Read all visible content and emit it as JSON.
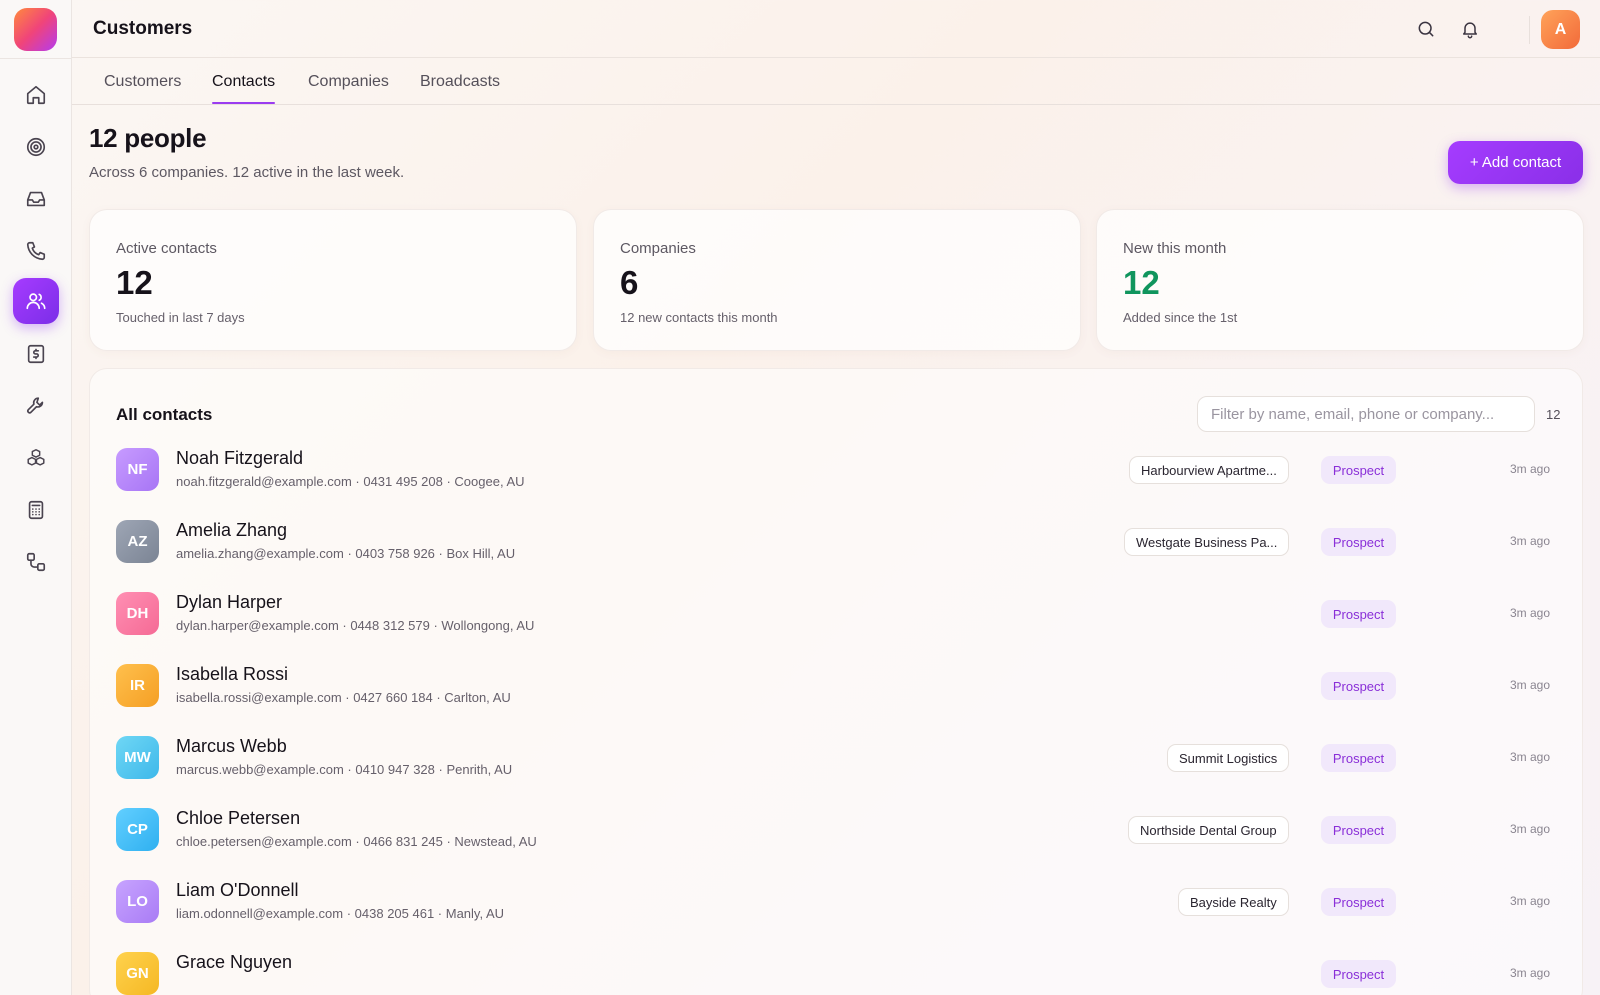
{
  "header": {
    "title": "Customers",
    "avatar_initial": "A"
  },
  "tabs": [
    {
      "label": "Customers",
      "active": false
    },
    {
      "label": "Contacts",
      "active": true
    },
    {
      "label": "Companies",
      "active": false
    },
    {
      "label": "Broadcasts",
      "active": false
    }
  ],
  "sidebar": {
    "items": [
      {
        "icon": "home-icon",
        "active": false
      },
      {
        "icon": "target-icon",
        "active": false
      },
      {
        "icon": "inbox-icon",
        "active": false
      },
      {
        "icon": "phone-icon",
        "active": false
      },
      {
        "icon": "users-icon",
        "active": true
      },
      {
        "icon": "invoice-icon",
        "active": false
      },
      {
        "icon": "wrench-icon",
        "active": false
      },
      {
        "icon": "boxes-icon",
        "active": false
      },
      {
        "icon": "calculator-icon",
        "active": false
      },
      {
        "icon": "workflow-icon",
        "active": false
      }
    ]
  },
  "page": {
    "headline": "12 people",
    "subhead": "Across 6 companies. 12 active in the last week.",
    "add_button": "+ Add contact"
  },
  "stats": [
    {
      "label": "Active contacts",
      "value": "12",
      "note": "Touched in last 7 days",
      "color": "#16121a"
    },
    {
      "label": "Companies",
      "value": "6",
      "note": "12 new contacts this month",
      "color": "#16121a"
    },
    {
      "label": "New this month",
      "value": "12",
      "note": "Added since the 1st",
      "color": "#10955d"
    }
  ],
  "list": {
    "title": "All contacts",
    "filter_placeholder": "Filter by name, email, phone or company...",
    "count": "12",
    "contacts": [
      {
        "initials": "NF",
        "name": "Noah Fitzgerald",
        "details": "noah.fitzgerald@example.com · 0431 495 208 · Coogee, AU",
        "company": "Harbourview Apartme...",
        "status": "Prospect",
        "time": "3m ago",
        "color_start": "#c79bff",
        "color_end": "#a775f5"
      },
      {
        "initials": "AZ",
        "name": "Amelia Zhang",
        "details": "amelia.zhang@example.com · 0403 758 926 · Box Hill, AU",
        "company": "Westgate Business Pa...",
        "status": "Prospect",
        "time": "3m ago",
        "color_start": "#9ea6b5",
        "color_end": "#7b8494"
      },
      {
        "initials": "DH",
        "name": "Dylan Harper",
        "details": "dylan.harper@example.com · 0448 312 579 · Wollongong, AU",
        "company": "",
        "status": "Prospect",
        "time": "3m ago",
        "color_start": "#ff8fb3",
        "color_end": "#f56a95"
      },
      {
        "initials": "IR",
        "name": "Isabella Rossi",
        "details": "isabella.rossi@example.com · 0427 660 184 · Carlton, AU",
        "company": "",
        "status": "Prospect",
        "time": "3m ago",
        "color_start": "#ffc04d",
        "color_end": "#f59f24"
      },
      {
        "initials": "MW",
        "name": "Marcus Webb",
        "details": "marcus.webb@example.com · 0410 947 328 · Penrith, AU",
        "company": "Summit Logistics",
        "status": "Prospect",
        "time": "3m ago",
        "color_start": "#6fd7f5",
        "color_end": "#3eb8ea"
      },
      {
        "initials": "CP",
        "name": "Chloe Petersen",
        "details": "chloe.petersen@example.com · 0466 831 245 · Newstead, AU",
        "company": "Northside Dental Group",
        "status": "Prospect",
        "time": "3m ago",
        "color_start": "#62cfff",
        "color_end": "#2fb0f0"
      },
      {
        "initials": "LO",
        "name": "Liam O'Donnell",
        "details": "liam.odonnell@example.com · 0438 205 461 · Manly, AU",
        "company": "Bayside Realty",
        "status": "Prospect",
        "time": "3m ago",
        "color_start": "#c7a3ff",
        "color_end": "#a97cf5"
      },
      {
        "initials": "GN",
        "name": "Grace Nguyen",
        "details": "",
        "company": "",
        "status": "Prospect",
        "time": "3m ago",
        "color_start": "#ffd24d",
        "color_end": "#f5b824"
      }
    ]
  }
}
